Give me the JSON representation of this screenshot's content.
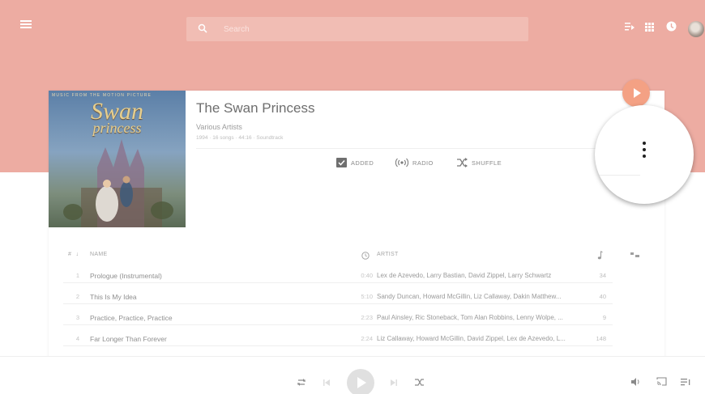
{
  "search": {
    "placeholder": "Search"
  },
  "album": {
    "cover_top_text": "MUSIC FROM THE MOTION PICTURE",
    "cover_logo_line1": "Swan",
    "cover_logo_line2": "princess",
    "title": "The Swan Princess",
    "artist": "Various Artists",
    "meta": "1994 · 16 songs · 44:16 · Soundtrack"
  },
  "actions": {
    "added": "ADDED",
    "radio": "RADIO",
    "shuffle": "SHUFFLE"
  },
  "table": {
    "header_num": "#",
    "header_name": "NAME",
    "header_artist": "ARTIST",
    "tracks": [
      {
        "num": "1",
        "name": "Prologue (Instrumental)",
        "duration": "0:40",
        "artist": "Lex de Azevedo, Larry Bastian, David Zippel, Larry Schwartz",
        "plays": "34"
      },
      {
        "num": "2",
        "name": "This Is My Idea",
        "duration": "5:10",
        "artist": "Sandy Duncan, Howard McGillin, Liz Callaway, Dakin Matthew...",
        "plays": "40"
      },
      {
        "num": "3",
        "name": "Practice, Practice, Practice",
        "duration": "2:23",
        "artist": "Paul Ainsley, Ric Stoneback, Tom Alan Robbins, Lenny Wolpe, ...",
        "plays": "9"
      },
      {
        "num": "4",
        "name": "Far Longer Than Forever",
        "duration": "2:24",
        "artist": "Liz Callaway, Howard McGillin, David Zippel, Lex de Azevedo, L...",
        "plays": "148"
      }
    ]
  },
  "colors": {
    "header_band": "#edaca2",
    "fab": "#f4a184",
    "accent_red": "#d6453a"
  },
  "icons": {
    "menu": "hamburger-menu-icon",
    "search": "search-icon",
    "queue": "queue-icon",
    "apps": "apps-grid-icon",
    "notifications": "notifications-icon",
    "more": "more-vert-icon"
  }
}
